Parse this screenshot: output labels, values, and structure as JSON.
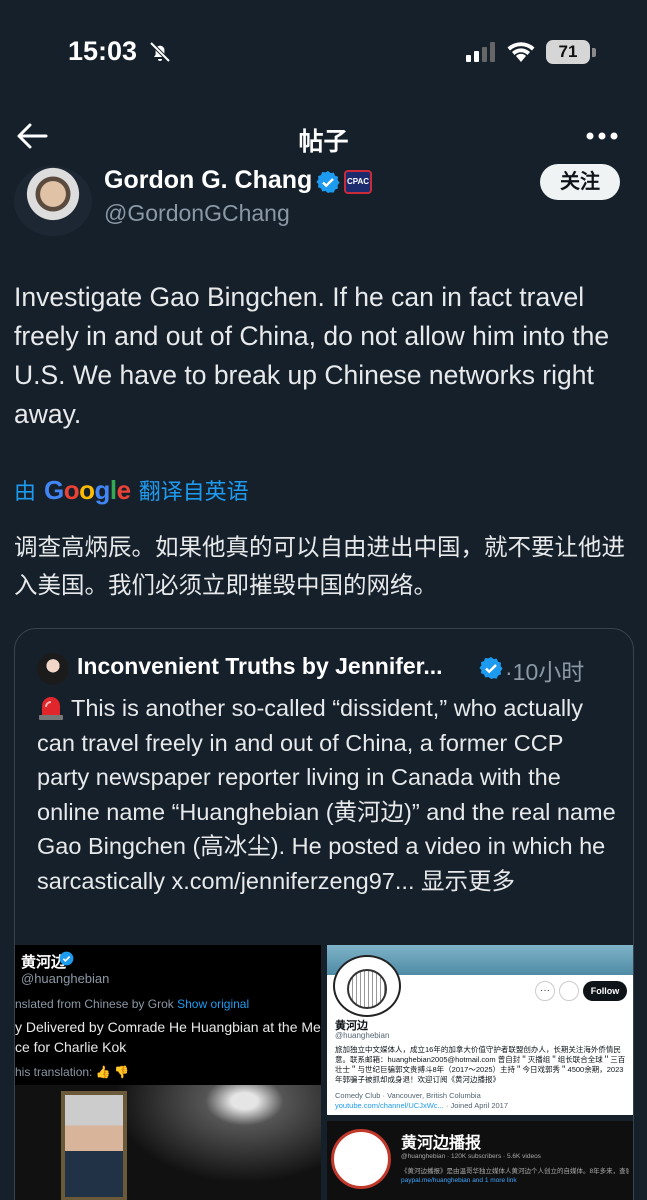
{
  "status_bar": {
    "time": "15:03",
    "battery": "71"
  },
  "nav": {
    "title": "帖子"
  },
  "author": {
    "name": "Gordon G. Chang",
    "handle": "@GordonGChang",
    "badge": "CPAC",
    "follow_label": "关注"
  },
  "tweet": {
    "text": "Investigate Gao Bingchen. If he can in fact travel freely in and out of China, do not allow him into the U.S. We have to break up Chinese networks right away.",
    "translated_prefix": "由",
    "translated_suffix": "翻译自英语",
    "translation": "调查高炳辰。如果他真的可以自由进出中国，就不要让他进入美国。我们必须立即摧毁中国的网络。"
  },
  "quote": {
    "name": "Inconvenient Truths by Jennifer...",
    "time": "·10小时",
    "text": "This is another so-called “dissident,” who actually can travel freely in and out of China, a former CCP party newspaper reporter living in Canada with the online name “Huanghebian (黄河边)” and the real name Gao Bingchen (高冰尘). He posted a video in which he sarcastically x.com/jenniferzeng97... 显示更多"
  },
  "media": {
    "left": {
      "name": "黄河边",
      "handle": "@huanghebian",
      "translated_from": "nslated from Chinese by Grok",
      "show_original": "Show original",
      "body_line1": "y Delivered by Comrade He Huangbian at the Mem",
      "body_line2": "ce for Charlie Kok",
      "rate": "his translation:"
    },
    "right_top": {
      "follow": "Follow",
      "name": "黄河边",
      "handle": "@huanghebian",
      "bio": "旅加独立中文媒体人，成立16年的加拿大价值守护者联盟创办人，长期关注海外侨情民意。联系邮箱：huanghebian2005@hotmail.com 曾自封＂灭播组＂组长联合全球＂三百壮士＂与世纪巨骗郭文贵搏斗8年（2017～2025）主持＂今日戏郭秀＂4500余期，2023年郭骗子被抓却成身退！欢迎订阅《黄河边播报》",
      "category": "Comedy Club",
      "location": "Vancouver, British Columbia",
      "link": "youtube.com/channel/UCJxWc...",
      "joined": "Joined April 2017"
    },
    "right_bottom": {
      "title": "黄河边播报",
      "meta": "@huanghebian · 120K subscribers · 5.6K videos",
      "desc": "《黄河边播报》是由温哥华独立媒体人黄河边个人创立的自媒体。8年多来，查验伪群黄...more",
      "link": "paypal.me/huanghebian and 1 more link"
    }
  },
  "colors": {
    "background": "#15202b",
    "accent": "#1d9bf0",
    "verified": "#1d9bf0"
  }
}
